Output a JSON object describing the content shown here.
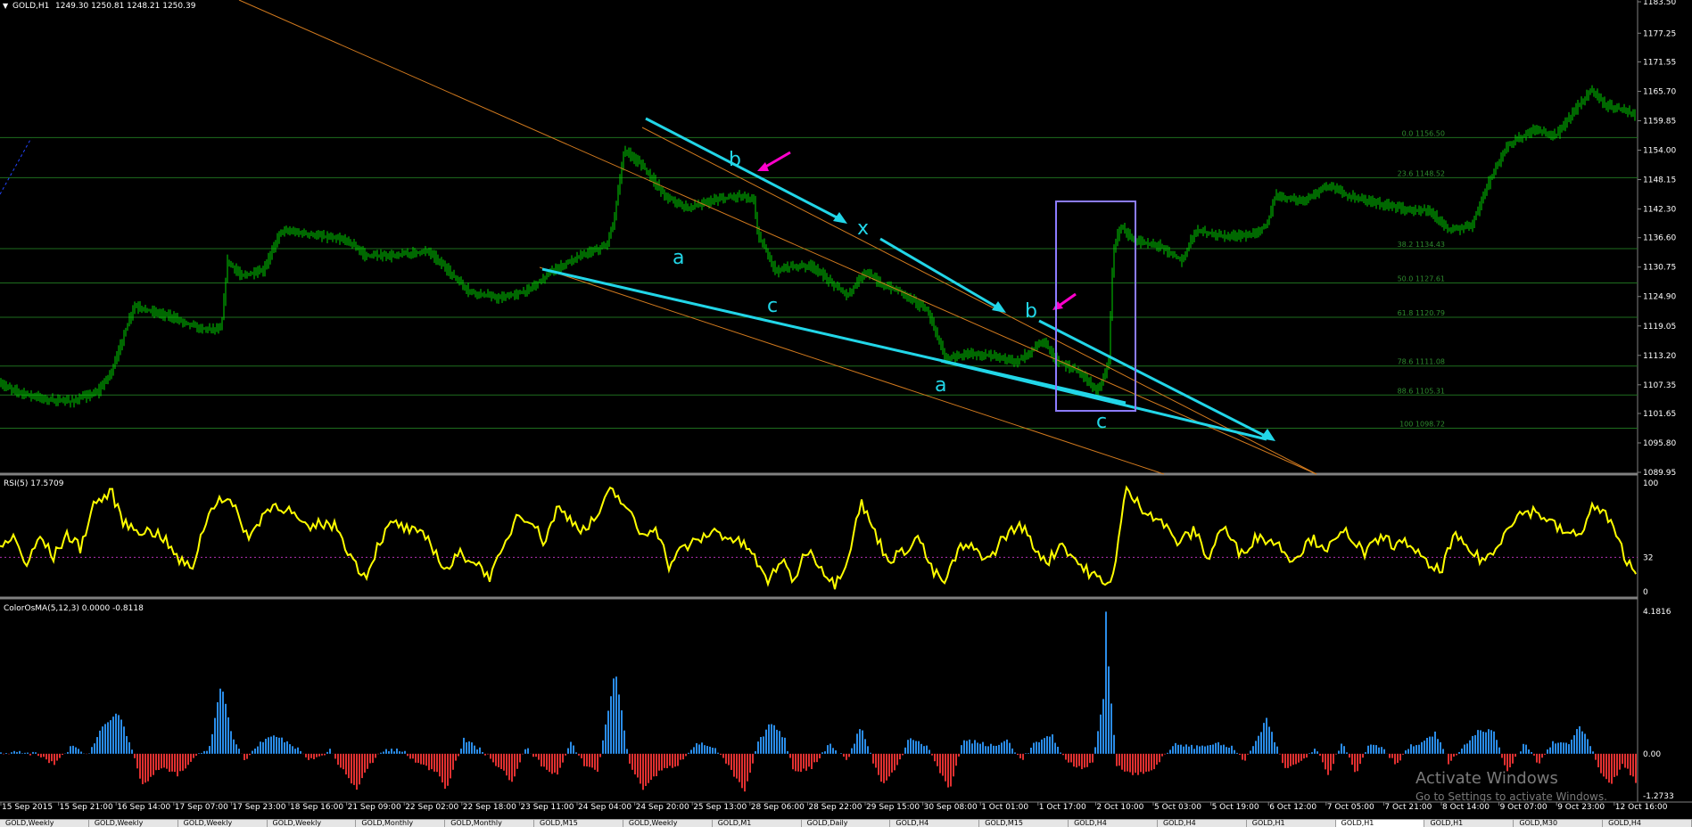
{
  "window": {
    "title": "GOLD,H1",
    "ohlc": "1249.30 1250.81 1248.21 1250.39"
  },
  "watermark": {
    "line1": "Activate Windows",
    "line2": "Go to Settings to activate Windows."
  },
  "tabs": [
    "GOLD,Weekly",
    "GOLD,Weekly",
    "GOLD,Weekly",
    "GOLD,Weekly",
    "GOLD,Monthly",
    "GOLD,Monthly",
    "GOLD,M15",
    "GOLD,Weekly",
    "GOLD,M1",
    "GOLD,Daily",
    "GOLD,H4",
    "GOLD,M15",
    "GOLD,H4",
    "GOLD,H4",
    "GOLD,H1",
    "GOLD,H1",
    "GOLD,H1",
    "GOLD,M30",
    "GOLD,H4"
  ],
  "active_tab": 15,
  "colors": {
    "background": "#000000",
    "candle": "#00d000",
    "fib_line": "#1e6e1e",
    "fib_label": "#2e8b2e",
    "wave_line": "#22d6e8",
    "channel_line": "#d27a1e",
    "rsi_line": "#ffff00",
    "rsi_level": "#b030b0",
    "osma_up": "#2a8ce8",
    "osma_down": "#e03030",
    "arrow_magenta": "#ff00cc",
    "box": "#8c7cff"
  },
  "chart_data": [
    {
      "type": "candlestick",
      "symbol": "GOLD",
      "timeframe": "H1",
      "ylim": [
        1089.95,
        1183.5
      ],
      "y_ticks": [
        "1183.50",
        "1177.25",
        "1171.55",
        "1165.70",
        "1159.85",
        "1154.00",
        "1148.15",
        "1142.30",
        "1136.60",
        "1130.75",
        "1124.90",
        "1119.05",
        "1113.20",
        "1107.35",
        "1101.65",
        "1095.80",
        "1089.95"
      ],
      "x_ticks": [
        "15 Sep 2015",
        "15 Sep 21:00",
        "16 Sep 14:00",
        "17 Sep 07:00",
        "17 Sep 23:00",
        "18 Sep 16:00",
        "21 Sep 09:00",
        "22 Sep 02:00",
        "22 Sep 18:00",
        "23 Sep 11:00",
        "24 Sep 04:00",
        "24 Sep 20:00",
        "25 Sep 13:00",
        "28 Sep 06:00",
        "28 Sep 22:00",
        "29 Sep 15:00",
        "30 Sep 08:00",
        "1 Oct 01:00",
        "1 Oct 17:00",
        "2 Oct 10:00",
        "5 Oct 03:00",
        "5 Oct 19:00",
        "6 Oct 12:00",
        "7 Oct 05:00",
        "7 Oct 21:00",
        "8 Oct 14:00",
        "9 Oct 07:00",
        "9 Oct 23:00",
        "12 Oct 16:00"
      ],
      "price_path_keypoints": [
        [
          0,
          1107.5
        ],
        [
          20,
          1106
        ],
        [
          50,
          1104.5
        ],
        [
          80,
          1104
        ],
        [
          110,
          1106
        ],
        [
          125,
          1110
        ],
        [
          150,
          1123
        ],
        [
          170,
          1122
        ],
        [
          190,
          1121
        ],
        [
          225,
          1118.5
        ],
        [
          248,
          1118.5
        ],
        [
          255,
          1132
        ],
        [
          270,
          1129
        ],
        [
          295,
          1130
        ],
        [
          315,
          1138
        ],
        [
          340,
          1137.5
        ],
        [
          390,
          1136
        ],
        [
          410,
          1133
        ],
        [
          440,
          1133
        ],
        [
          480,
          1134
        ],
        [
          500,
          1130.5
        ],
        [
          525,
          1126
        ],
        [
          560,
          1124.5
        ],
        [
          590,
          1126
        ],
        [
          620,
          1130
        ],
        [
          650,
          1133
        ],
        [
          680,
          1135
        ],
        [
          688,
          1140
        ],
        [
          700,
          1154
        ],
        [
          720,
          1151
        ],
        [
          745,
          1145
        ],
        [
          770,
          1142.5
        ],
        [
          800,
          1144
        ],
        [
          830,
          1145
        ],
        [
          845,
          1144
        ],
        [
          850,
          1137
        ],
        [
          870,
          1130
        ],
        [
          890,
          1131
        ],
        [
          910,
          1131
        ],
        [
          930,
          1128
        ],
        [
          950,
          1125
        ],
        [
          970,
          1130
        ],
        [
          990,
          1127
        ],
        [
          1010,
          1126
        ],
        [
          1040,
          1122
        ],
        [
          1060,
          1112.5
        ],
        [
          1085,
          1113.5
        ],
        [
          1120,
          1113
        ],
        [
          1140,
          1112
        ],
        [
          1155,
          1114
        ],
        [
          1170,
          1116
        ],
        [
          1185,
          1112
        ],
        [
          1210,
          1110
        ],
        [
          1230,
          1106
        ],
        [
          1236,
          1108
        ],
        [
          1243,
          1112
        ],
        [
          1248,
          1134
        ],
        [
          1256,
          1139
        ],
        [
          1270,
          1136
        ],
        [
          1300,
          1135
        ],
        [
          1325,
          1132
        ],
        [
          1340,
          1138
        ],
        [
          1370,
          1137
        ],
        [
          1400,
          1137
        ],
        [
          1420,
          1139
        ],
        [
          1430,
          1145
        ],
        [
          1460,
          1144
        ],
        [
          1490,
          1147
        ],
        [
          1510,
          1145
        ],
        [
          1530,
          1144
        ],
        [
          1560,
          1143
        ],
        [
          1580,
          1142
        ],
        [
          1600,
          1142
        ],
        [
          1615,
          1140
        ],
        [
          1625,
          1138
        ],
        [
          1650,
          1139
        ],
        [
          1670,
          1148
        ],
        [
          1690,
          1155
        ],
        [
          1720,
          1158
        ],
        [
          1745,
          1157
        ],
        [
          1770,
          1163
        ],
        [
          1785,
          1166
        ],
        [
          1800,
          1163
        ],
        [
          1820,
          1162
        ],
        [
          1834,
          1161
        ]
      ],
      "fibonacci": [
        {
          "label": "0.0 1156.50",
          "price": 1156.5
        },
        {
          "label": "23.6 1148.52",
          "price": 1148.52
        },
        {
          "label": "38.2 1134.43",
          "price": 1134.43
        },
        {
          "label": "50.0 1127.61",
          "price": 1127.61
        },
        {
          "label": "61.8 1120.79",
          "price": 1120.79
        },
        {
          "label": "78.6 1111.08",
          "price": 1111.08
        },
        {
          "label": "88.6 1105.31",
          "price": 1105.31
        },
        {
          "label": "100 1098.72",
          "price": 1098.72
        }
      ],
      "wave_labels": [
        "a",
        "b",
        "c",
        "x",
        "a",
        "b",
        "c"
      ]
    },
    {
      "type": "line",
      "title": "RSI(5) 17.5709",
      "ylim": [
        0,
        100
      ],
      "y_ticks": [
        "100",
        "32",
        "0"
      ],
      "level": 32,
      "keypoints": [
        [
          0,
          40
        ],
        [
          15,
          50
        ],
        [
          30,
          25
        ],
        [
          45,
          50
        ],
        [
          60,
          32
        ],
        [
          75,
          52
        ],
        [
          90,
          40
        ],
        [
          105,
          78
        ],
        [
          125,
          88
        ],
        [
          140,
          60
        ],
        [
          160,
          55
        ],
        [
          180,
          52
        ],
        [
          200,
          30
        ],
        [
          215,
          22
        ],
        [
          230,
          62
        ],
        [
          245,
          85
        ],
        [
          260,
          78
        ],
        [
          280,
          48
        ],
        [
          295,
          70
        ],
        [
          310,
          78
        ],
        [
          325,
          72
        ],
        [
          345,
          55
        ],
        [
          360,
          62
        ],
        [
          378,
          58
        ],
        [
          395,
          30
        ],
        [
          410,
          15
        ],
        [
          425,
          45
        ],
        [
          440,
          62
        ],
        [
          460,
          55
        ],
        [
          480,
          48
        ],
        [
          500,
          20
        ],
        [
          515,
          35
        ],
        [
          530,
          30
        ],
        [
          550,
          15
        ],
        [
          565,
          40
        ],
        [
          580,
          70
        ],
        [
          595,
          65
        ],
        [
          610,
          45
        ],
        [
          625,
          75
        ],
        [
          640,
          65
        ],
        [
          655,
          55
        ],
        [
          670,
          68
        ],
        [
          685,
          90
        ],
        [
          700,
          78
        ],
        [
          720,
          50
        ],
        [
          735,
          60
        ],
        [
          750,
          25
        ],
        [
          765,
          40
        ],
        [
          780,
          45
        ],
        [
          800,
          55
        ],
        [
          820,
          48
        ],
        [
          840,
          40
        ],
        [
          860,
          10
        ],
        [
          875,
          30
        ],
        [
          890,
          12
        ],
        [
          905,
          40
        ],
        [
          920,
          25
        ],
        [
          935,
          8
        ],
        [
          950,
          30
        ],
        [
          965,
          80
        ],
        [
          980,
          55
        ],
        [
          995,
          30
        ],
        [
          1010,
          35
        ],
        [
          1030,
          50
        ],
        [
          1045,
          20
        ],
        [
          1060,
          10
        ],
        [
          1075,
          40
        ],
        [
          1090,
          40
        ],
        [
          1110,
          30
        ],
        [
          1125,
          50
        ],
        [
          1145,
          60
        ],
        [
          1160,
          40
        ],
        [
          1175,
          28
        ],
        [
          1190,
          45
        ],
        [
          1200,
          35
        ],
        [
          1215,
          22
        ],
        [
          1230,
          15
        ],
        [
          1240,
          5
        ],
        [
          1250,
          25
        ],
        [
          1262,
          90
        ],
        [
          1280,
          75
        ],
        [
          1300,
          65
        ],
        [
          1320,
          45
        ],
        [
          1340,
          55
        ],
        [
          1355,
          30
        ],
        [
          1370,
          60
        ],
        [
          1390,
          35
        ],
        [
          1410,
          50
        ],
        [
          1430,
          45
        ],
        [
          1450,
          30
        ],
        [
          1470,
          48
        ],
        [
          1490,
          40
        ],
        [
          1510,
          55
        ],
        [
          1530,
          35
        ],
        [
          1550,
          50
        ],
        [
          1565,
          42
        ],
        [
          1580,
          45
        ],
        [
          1600,
          25
        ],
        [
          1615,
          20
        ],
        [
          1630,
          50
        ],
        [
          1645,
          40
        ],
        [
          1660,
          30
        ],
        [
          1675,
          35
        ],
        [
          1690,
          60
        ],
        [
          1705,
          70
        ],
        [
          1720,
          72
        ],
        [
          1735,
          65
        ],
        [
          1750,
          55
        ],
        [
          1770,
          50
        ],
        [
          1785,
          75
        ],
        [
          1800,
          70
        ],
        [
          1815,
          45
        ],
        [
          1825,
          28
        ],
        [
          1834,
          17.57
        ]
      ]
    },
    {
      "type": "bar",
      "title": "ColorOsMA(5,12,3) 0.0000 -0.8118",
      "ylim": [
        -1.2733,
        4.1816
      ],
      "y_ticks": [
        "4.1816",
        "0.00",
        "-1.2733"
      ],
      "keypoints": [
        [
          0,
          0.05
        ],
        [
          40,
          0.0
        ],
        [
          60,
          -0.3
        ],
        [
          80,
          0.2
        ],
        [
          100,
          0.0
        ],
        [
          115,
          0.8
        ],
        [
          132,
          1.2
        ],
        [
          145,
          0.3
        ],
        [
          160,
          -0.9
        ],
        [
          180,
          -0.4
        ],
        [
          200,
          -0.6
        ],
        [
          215,
          -0.2
        ],
        [
          235,
          0.2
        ],
        [
          248,
          2.0
        ],
        [
          260,
          0.5
        ],
        [
          275,
          -0.2
        ],
        [
          290,
          0.3
        ],
        [
          310,
          0.5
        ],
        [
          330,
          0.2
        ],
        [
          350,
          -0.2
        ],
        [
          370,
          0.1
        ],
        [
          385,
          -0.5
        ],
        [
          400,
          -1.0
        ],
        [
          415,
          -0.3
        ],
        [
          430,
          0.1
        ],
        [
          450,
          0.1
        ],
        [
          470,
          -0.3
        ],
        [
          490,
          -0.5
        ],
        [
          500,
          -1.0
        ],
        [
          520,
          0.4
        ],
        [
          540,
          0.1
        ],
        [
          560,
          -0.4
        ],
        [
          575,
          -0.8
        ],
        [
          590,
          0.2
        ],
        [
          610,
          -0.4
        ],
        [
          625,
          -0.6
        ],
        [
          640,
          0.3
        ],
        [
          655,
          -0.3
        ],
        [
          670,
          -0.5
        ],
        [
          690,
          2.4
        ],
        [
          705,
          -0.2
        ],
        [
          720,
          -1.0
        ],
        [
          740,
          -0.5
        ],
        [
          760,
          -0.3
        ],
        [
          780,
          0.3
        ],
        [
          800,
          0.2
        ],
        [
          815,
          -0.3
        ],
        [
          835,
          -1.1
        ],
        [
          850,
          0.3
        ],
        [
          865,
          0.9
        ],
        [
          880,
          0.4
        ],
        [
          890,
          -0.5
        ],
        [
          910,
          -0.4
        ],
        [
          930,
          0.3
        ],
        [
          950,
          -0.2
        ],
        [
          965,
          0.8
        ],
        [
          980,
          -0.3
        ],
        [
          990,
          -0.9
        ],
        [
          1005,
          -0.4
        ],
        [
          1020,
          0.5
        ],
        [
          1040,
          0.2
        ],
        [
          1055,
          -0.6
        ],
        [
          1065,
          -1.0
        ],
        [
          1080,
          0.4
        ],
        [
          1100,
          0.3
        ],
        [
          1115,
          0.2
        ],
        [
          1130,
          0.4
        ],
        [
          1145,
          -0.2
        ],
        [
          1160,
          0.3
        ],
        [
          1180,
          0.5
        ],
        [
          1195,
          -0.2
        ],
        [
          1210,
          -0.4
        ],
        [
          1225,
          -0.3
        ],
        [
          1237,
          1.6
        ],
        [
          1240,
          4.0
        ],
        [
          1244,
          2.0
        ],
        [
          1252,
          -0.3
        ],
        [
          1270,
          -0.6
        ],
        [
          1290,
          -0.5
        ],
        [
          1300,
          -0.2
        ],
        [
          1320,
          0.3
        ],
        [
          1335,
          0.2
        ],
        [
          1345,
          0.2
        ],
        [
          1360,
          0.3
        ],
        [
          1380,
          0.2
        ],
        [
          1395,
          -0.2
        ],
        [
          1410,
          0.4
        ],
        [
          1420,
          1.0
        ],
        [
          1440,
          -0.4
        ],
        [
          1455,
          -0.3
        ],
        [
          1475,
          0.2
        ],
        [
          1490,
          -0.6
        ],
        [
          1505,
          0.4
        ],
        [
          1520,
          -0.6
        ],
        [
          1535,
          0.3
        ],
        [
          1550,
          0.2
        ],
        [
          1565,
          -0.3
        ],
        [
          1580,
          0.2
        ],
        [
          1595,
          0.3
        ],
        [
          1610,
          0.6
        ],
        [
          1625,
          -0.3
        ],
        [
          1640,
          0.2
        ],
        [
          1660,
          0.7
        ],
        [
          1675,
          0.6
        ],
        [
          1690,
          -0.5
        ],
        [
          1710,
          0.3
        ],
        [
          1725,
          -0.3
        ],
        [
          1740,
          0.3
        ],
        [
          1760,
          0.3
        ],
        [
          1770,
          0.8
        ],
        [
          1782,
          0.3
        ],
        [
          1795,
          -0.6
        ],
        [
          1805,
          -0.9
        ],
        [
          1820,
          -0.3
        ],
        [
          1834,
          -0.81
        ]
      ]
    }
  ]
}
